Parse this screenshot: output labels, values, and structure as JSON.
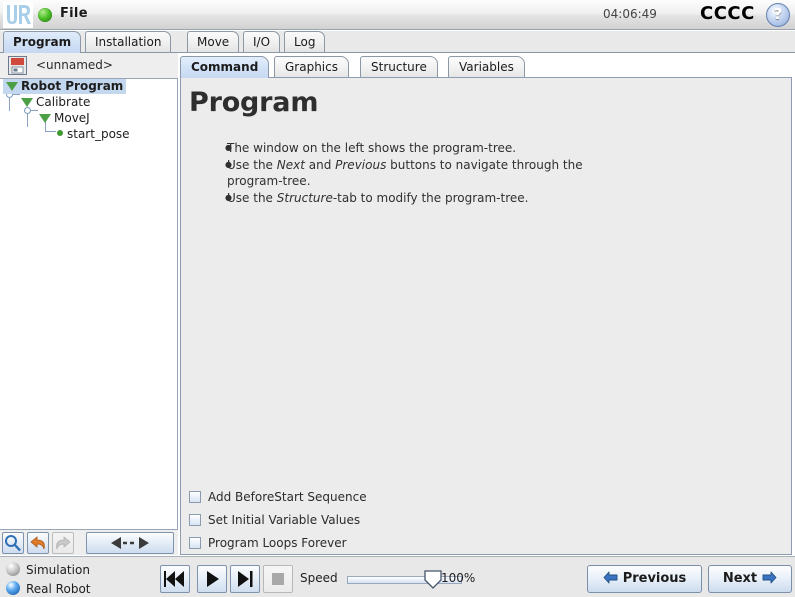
{
  "header": {
    "logo_alt": "ur-logo",
    "file_menu": "File",
    "clock": "04:06:49",
    "robot_name": "CCCC",
    "help": "?"
  },
  "main_tabs": [
    {
      "label": "Program",
      "active": true
    },
    {
      "label": "Installation",
      "active": false
    },
    {
      "label": "Move",
      "active": false
    },
    {
      "label": "I/O",
      "active": false
    },
    {
      "label": "Log",
      "active": false
    }
  ],
  "program_panel": {
    "file_name": "<unnamed>",
    "tree": [
      {
        "label": "Robot Program",
        "depth": 0,
        "type": "folder",
        "selected": true
      },
      {
        "label": "Calibrate",
        "depth": 1,
        "type": "folder",
        "selected": false
      },
      {
        "label": "MoveJ",
        "depth": 2,
        "type": "folder",
        "selected": false
      },
      {
        "label": "start_pose",
        "depth": 3,
        "type": "waypoint",
        "selected": false
      }
    ],
    "tools": [
      {
        "name": "search-icon",
        "enabled": true
      },
      {
        "name": "undo-icon",
        "enabled": true
      },
      {
        "name": "redo-icon",
        "enabled": false
      },
      {
        "name": "move-indent-control",
        "enabled": true
      }
    ]
  },
  "sub_tabs": [
    {
      "label": "Command",
      "active": true
    },
    {
      "label": "Graphics",
      "active": false
    },
    {
      "label": "Structure",
      "active": false
    },
    {
      "label": "Variables",
      "active": false
    }
  ],
  "command": {
    "title": "Program",
    "bullets": [
      {
        "prefix": "The window on the left shows the program-tree.",
        "parts": []
      },
      {
        "prefix": "",
        "parts": []
      },
      {
        "prefix": "",
        "parts": []
      }
    ],
    "bullet1": "The window on the left shows the program-tree.",
    "bullet2_a": "Use the ",
    "bullet2_i1": "Next",
    "bullet2_b": " and ",
    "bullet2_i2": "Previous",
    "bullet2_c": " buttons to navigate through the program-tree.",
    "bullet3_a": "Use the ",
    "bullet3_i1": "Structure",
    "bullet3_b": "-tab to modify the program-tree.",
    "checkboxes": [
      {
        "label": "Add BeforeStart Sequence",
        "checked": false
      },
      {
        "label": "Set Initial Variable Values",
        "checked": false
      },
      {
        "label": "Program Loops Forever",
        "checked": false
      }
    ]
  },
  "bottom": {
    "simulation_label": "Simulation",
    "real_robot_label": "Real Robot",
    "active_mode": "Real Robot",
    "transport": [
      {
        "name": "rewind-button",
        "enabled": true
      },
      {
        "name": "play-button",
        "enabled": true
      },
      {
        "name": "step-button",
        "enabled": true
      },
      {
        "name": "stop-button",
        "enabled": false
      }
    ],
    "speed_label": "Speed",
    "speed_value": "100%",
    "speed_percent": 100,
    "previous_label": "Previous",
    "next_label": "Next"
  },
  "colors": {
    "accent_blue": "#c5d9f2",
    "tree_green": "#4c9f45",
    "border": "#8e9cb1",
    "panel_bg": "#ececec"
  }
}
